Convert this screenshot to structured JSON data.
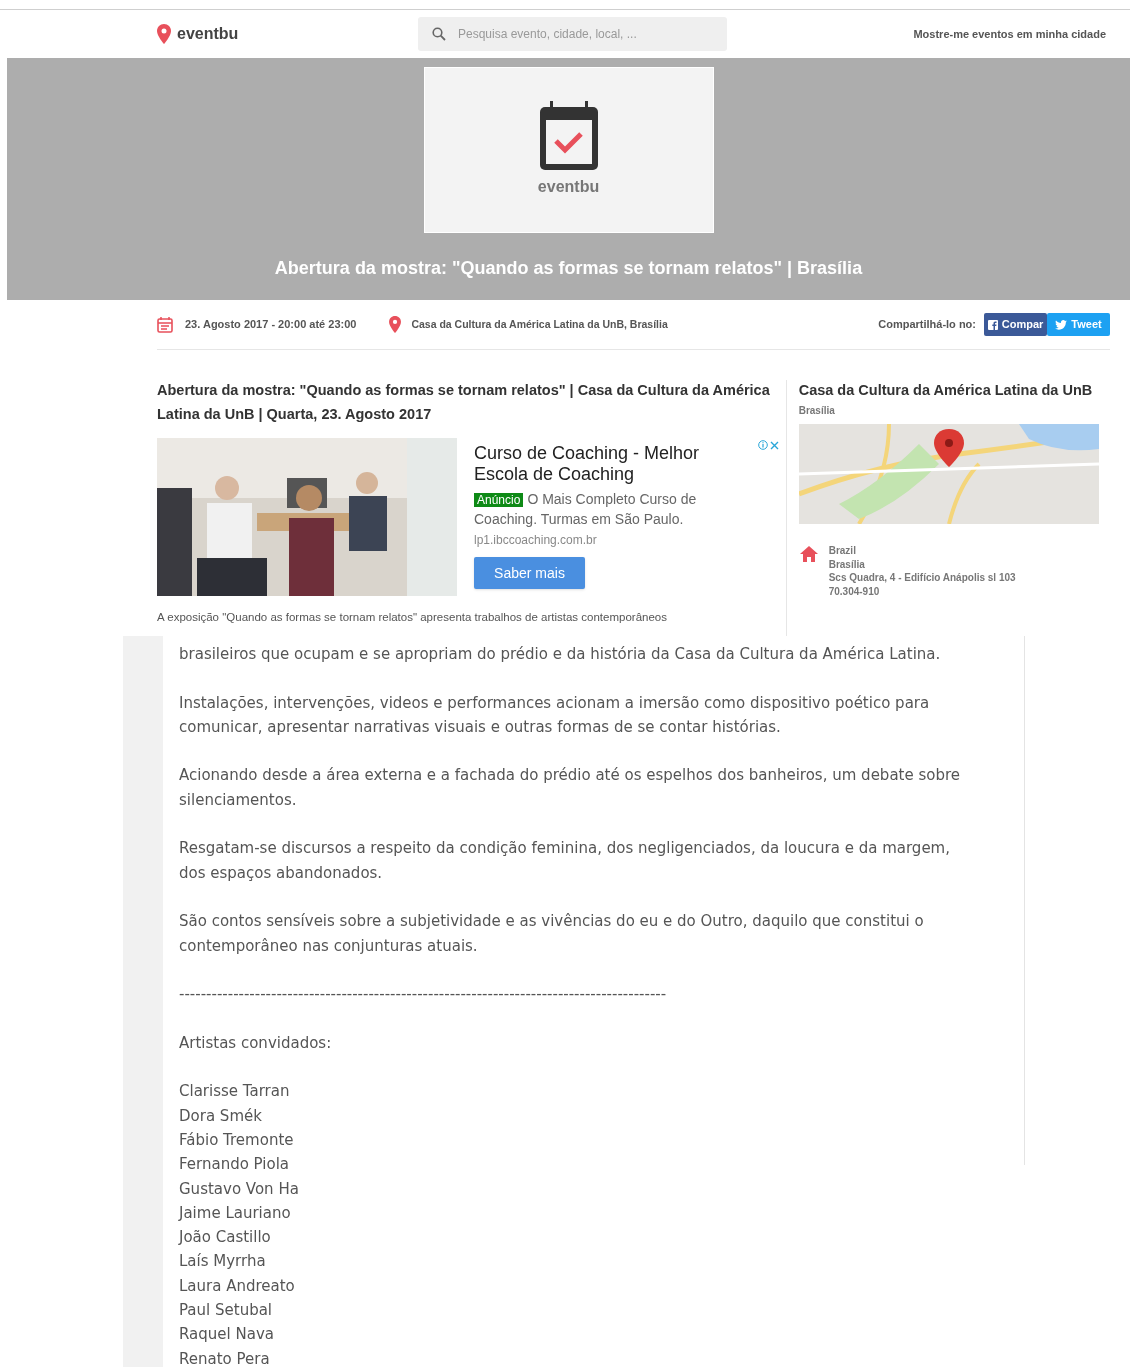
{
  "header": {
    "logo": "eventbu",
    "search": {
      "placeholder": "Pesquisa evento, cidade, local, ..."
    },
    "city_link": "Mostre-me eventos em minha cidade"
  },
  "banner": {
    "logo_text": "eventbu",
    "title": "Abertura da mostra: \"Quando as formas se tornam relatos\" | Brasília"
  },
  "info": {
    "date": "23. Agosto 2017 - 20:00 até 23:00",
    "venue": "Casa da Cultura da América Latina da UnB, Brasília",
    "share_label": "Compartilhá-lo no:",
    "share_buttons": [
      {
        "kind": "facebook",
        "label": "Compar"
      },
      {
        "kind": "twitter",
        "label": "Tweet"
      }
    ]
  },
  "event": {
    "heading": "Abertura da mostra: \"Quando as formas se tornam relatos\" | Casa da Cultura da América Latina da UnB | Quarta, 23. Agosto 2017",
    "ad": {
      "title": "Curso de Coaching - Melhor Escola de Coaching",
      "badge": "Anúncio",
      "text": "O Mais Completo Curso de Coaching. Turmas em São Paulo.",
      "url": "lp1.ibccoaching.com.br",
      "button": "Saber mais"
    },
    "intro": "A exposição \"Quando as formas se tornam relatos\" apresenta trabalhos de artistas contemporâneos"
  },
  "venue_card": {
    "name": "Casa da Cultura da América Latina da UnB",
    "city": "Brasília",
    "address": [
      "Brazil",
      "Brasília",
      "Scs Quadra, 4 - Edifício Anápolis sl 103",
      "70.304-910"
    ]
  },
  "description": {
    "paragraphs": [
      "brasileiros que ocupam e se apropriam do prédio e da história da Casa da Cultura da América Latina.",
      "Instalações, intervenções, videos e performances acionam a imersão como dispositivo poético para comunicar, apresentar narrativas visuais e outras formas de se contar histórias.",
      "Acionando desde a área externa e a fachada do prédio até os espelhos dos banheiros, um debate sobre silenciamentos.",
      "Resgatam-se discursos a respeito da condição feminina, dos negligenciados, da loucura e da margem, dos espaços abandonados.",
      "São contos sensíveis sobre a subjetividade e as vivências do eu e do Outro, daquilo que constitui o contemporâneo nas conjunturas atuais.",
      "------------------------------------------------------------------------------------------",
      "Artistas convidados:"
    ],
    "artists": [
      "Clarisse Tarran",
      "Dora Smék",
      "Fábio Tremonte",
      "Fernando Piola",
      "Gustavo Von Ha",
      "Jaime Lauriano",
      "João Castillo",
      "Laís Myrrha",
      "Laura Andreato",
      "Paul Setubal",
      "Raquel Nava",
      "Renato Pera"
    ]
  }
}
